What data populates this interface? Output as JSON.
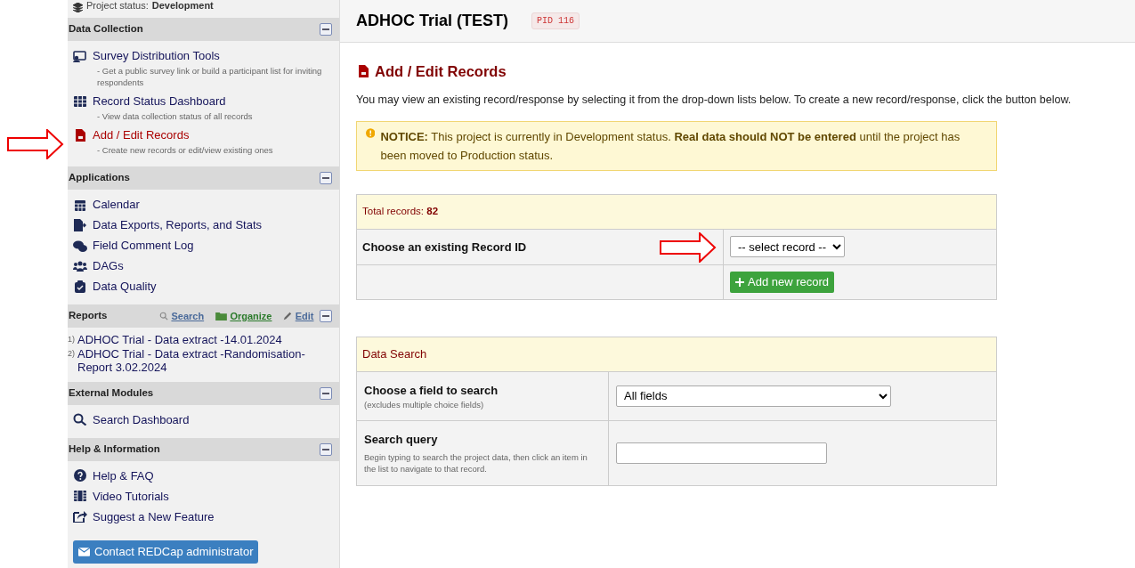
{
  "sidebar": {
    "project_status": {
      "label": "Project status:",
      "value": "Development"
    },
    "sections": [
      {
        "kind": "nav",
        "title": "Data Collection",
        "items": [
          {
            "label": "Survey Distribution Tools",
            "description": "- Get a public survey link or build a participant list for inviting respondents",
            "selected": false
          },
          {
            "label": "Record Status Dashboard",
            "description": "- View data collection status of all records",
            "selected": false
          },
          {
            "label": "Add / Edit Records",
            "description": "- Create new records or edit/view existing ones",
            "selected": true
          }
        ]
      },
      {
        "kind": "nav",
        "title": "Applications",
        "items": [
          {
            "label": "Calendar",
            "selected": false
          },
          {
            "label": "Data Exports, Reports, and Stats",
            "selected": false
          },
          {
            "label": "Field Comment Log",
            "selected": false
          },
          {
            "label": "DAGs",
            "selected": false
          },
          {
            "label": "Data Quality",
            "selected": false
          }
        ]
      },
      {
        "kind": "reports",
        "title": "Reports",
        "links": [
          "Search",
          "Organize",
          "Edit"
        ],
        "items": [
          {
            "number": "1)",
            "label": "ADHOC Trial - Data extract -14.01.2024"
          },
          {
            "number": "2)",
            "label": "ADHOC Trial - Data extract -Randomisation-Report 3.02.2024"
          }
        ]
      },
      {
        "kind": "nav",
        "title": "External Modules",
        "items": [
          {
            "label": "Search Dashboard",
            "selected": false
          }
        ]
      },
      {
        "kind": "nav",
        "title": "Help & Information",
        "items": [
          {
            "label": "Help & FAQ",
            "selected": false
          },
          {
            "label": "Video Tutorials",
            "selected": false
          },
          {
            "label": "Suggest a New Feature",
            "selected": false
          }
        ]
      }
    ],
    "contact_button": "Contact REDCap administrator"
  },
  "project": {
    "title": "ADHOC Trial (TEST)",
    "pid": "PID 116"
  },
  "page": {
    "heading": "Add / Edit Records",
    "intro": "You may view an existing record/response by selecting it from the drop-down lists below. To create a new record/response, click the button below.",
    "notice": "**NOTICE:** This project is currently in Development status. **Real data should NOT be entered** until the project has been moved to Production status."
  },
  "records_table": {
    "header_label": "Total records:",
    "header_count": "82",
    "choose_label": "Choose an existing Record ID",
    "select_value": "-- select record --",
    "add_button": "Add new record"
  },
  "search_table": {
    "header": "Data Search",
    "field_label": "Choose a field to search",
    "field_hint": "(excludes multiple choice fields)",
    "field_value": "All fields",
    "query_label": "Search query",
    "query_hint": "Begin typing to search the project data, then click an item in the list to navigate to that record."
  }
}
